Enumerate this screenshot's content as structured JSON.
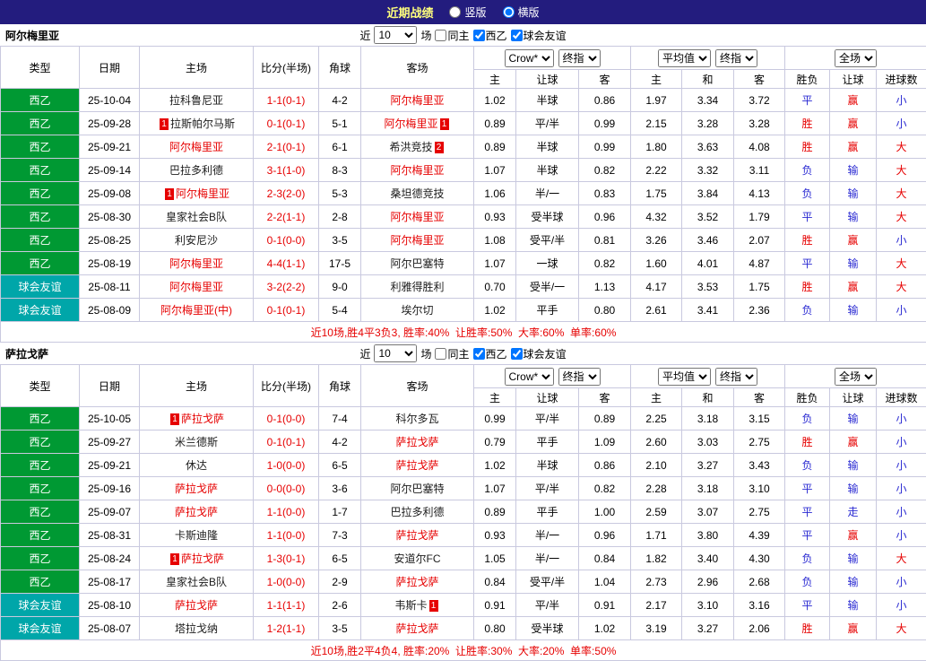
{
  "topbar": {
    "title": "近期战绩",
    "options": [
      {
        "label": "竖版",
        "selected": false
      },
      {
        "label": "横版",
        "selected": true
      }
    ]
  },
  "filterbar": {
    "near_prefix": "近",
    "near_value": "10",
    "near_suffix": "场",
    "checkboxes": [
      {
        "label": "同主",
        "checked": false
      },
      {
        "label": "西乙",
        "checked": true
      },
      {
        "label": "球会友谊",
        "checked": true
      }
    ]
  },
  "table_header": {
    "type": "类型",
    "date": "日期",
    "home": "主场",
    "score": "比分(半场)",
    "corner": "角球",
    "away": "客场",
    "odds_group": {
      "bookmaker": "Crow*",
      "final_label": "终指",
      "cols": [
        "主",
        "让球",
        "客"
      ]
    },
    "avg_group": {
      "label": "平均值",
      "final_label": "终指",
      "cols": [
        "主",
        "和",
        "客"
      ]
    },
    "full_group": {
      "label": "全场",
      "cols": [
        "胜负",
        "让球",
        "进球数"
      ]
    }
  },
  "colors": {
    "league_badge": "#009933",
    "friendly_badge": "#00a6a9",
    "win_red": "#e60000",
    "lose_blue": "#2a2ad2",
    "topbar_bg": "#231c7e",
    "topbar_title": "#ffff7d"
  },
  "sections": [
    {
      "team": "阿尔梅里亚",
      "summary": "近10场,胜4平3负3, 胜率:40%  让胜率:50%  大率:60%  单率:60%",
      "rows": [
        {
          "type": "西乙",
          "type_key": "league",
          "date": "25-10-04",
          "home": "拉科鲁尼亚",
          "home_card": "",
          "home_focal": false,
          "score": "1-1(0-1)",
          "corner": "4-2",
          "away": "阿尔梅里亚",
          "away_card": "",
          "away_focal": true,
          "odds": [
            "1.02",
            "半球",
            "0.86"
          ],
          "avg": [
            "1.97",
            "3.34",
            "3.72"
          ],
          "results": [
            "平",
            "赢",
            "小"
          ],
          "result_colors": [
            "blue",
            "red",
            "blue"
          ]
        },
        {
          "type": "西乙",
          "type_key": "league",
          "date": "25-09-28",
          "home": "拉斯帕尔马斯",
          "home_card": "1",
          "home_focal": false,
          "score": "0-1(0-1)",
          "corner": "5-1",
          "away": "阿尔梅里亚",
          "away_card": "1",
          "away_focal": true,
          "odds": [
            "0.89",
            "平/半",
            "0.99"
          ],
          "avg": [
            "2.15",
            "3.28",
            "3.28"
          ],
          "results": [
            "胜",
            "赢",
            "小"
          ],
          "result_colors": [
            "red",
            "red",
            "blue"
          ]
        },
        {
          "type": "西乙",
          "type_key": "league",
          "date": "25-09-21",
          "home": "阿尔梅里亚",
          "home_card": "",
          "home_focal": true,
          "score": "2-1(0-1)",
          "corner": "6-1",
          "away": "希洪竞技",
          "away_card": "2",
          "away_focal": false,
          "odds": [
            "0.89",
            "半球",
            "0.99"
          ],
          "avg": [
            "1.80",
            "3.63",
            "4.08"
          ],
          "results": [
            "胜",
            "赢",
            "大"
          ],
          "result_colors": [
            "red",
            "red",
            "red"
          ]
        },
        {
          "type": "西乙",
          "type_key": "league",
          "date": "25-09-14",
          "home": "巴拉多利德",
          "home_card": "",
          "home_focal": false,
          "score": "3-1(1-0)",
          "corner": "8-3",
          "away": "阿尔梅里亚",
          "away_card": "",
          "away_focal": true,
          "odds": [
            "1.07",
            "半球",
            "0.82"
          ],
          "avg": [
            "2.22",
            "3.32",
            "3.11"
          ],
          "results": [
            "负",
            "输",
            "大"
          ],
          "result_colors": [
            "blue",
            "blue",
            "red"
          ]
        },
        {
          "type": "西乙",
          "type_key": "league",
          "date": "25-09-08",
          "home": "阿尔梅里亚",
          "home_card": "1",
          "home_focal": true,
          "score": "2-3(2-0)",
          "corner": "5-3",
          "away": "桑坦德竞技",
          "away_card": "",
          "away_focal": false,
          "odds": [
            "1.06",
            "半/一",
            "0.83"
          ],
          "avg": [
            "1.75",
            "3.84",
            "4.13"
          ],
          "results": [
            "负",
            "输",
            "大"
          ],
          "result_colors": [
            "blue",
            "blue",
            "red"
          ]
        },
        {
          "type": "西乙",
          "type_key": "league",
          "date": "25-08-30",
          "home": "皇家社会B队",
          "home_card": "",
          "home_focal": false,
          "score": "2-2(1-1)",
          "corner": "2-8",
          "away": "阿尔梅里亚",
          "away_card": "",
          "away_focal": true,
          "odds": [
            "0.93",
            "受半球",
            "0.96"
          ],
          "avg": [
            "4.32",
            "3.52",
            "1.79"
          ],
          "results": [
            "平",
            "输",
            "大"
          ],
          "result_colors": [
            "blue",
            "blue",
            "red"
          ]
        },
        {
          "type": "西乙",
          "type_key": "league",
          "date": "25-08-25",
          "home": "利安尼沙",
          "home_card": "",
          "home_focal": false,
          "score": "0-1(0-0)",
          "corner": "3-5",
          "away": "阿尔梅里亚",
          "away_card": "",
          "away_focal": true,
          "odds": [
            "1.08",
            "受平/半",
            "0.81"
          ],
          "avg": [
            "3.26",
            "3.46",
            "2.07"
          ],
          "results": [
            "胜",
            "赢",
            "小"
          ],
          "result_colors": [
            "red",
            "red",
            "blue"
          ]
        },
        {
          "type": "西乙",
          "type_key": "league",
          "date": "25-08-19",
          "home": "阿尔梅里亚",
          "home_card": "",
          "home_focal": true,
          "score": "4-4(1-1)",
          "corner": "17-5",
          "away": "阿尔巴塞特",
          "away_card": "",
          "away_focal": false,
          "odds": [
            "1.07",
            "一球",
            "0.82"
          ],
          "avg": [
            "1.60",
            "4.01",
            "4.87"
          ],
          "results": [
            "平",
            "输",
            "大"
          ],
          "result_colors": [
            "blue",
            "blue",
            "red"
          ]
        },
        {
          "type": "球会友谊",
          "type_key": "friendly",
          "date": "25-08-11",
          "home": "阿尔梅里亚",
          "home_card": "",
          "home_focal": true,
          "score": "3-2(2-2)",
          "corner": "9-0",
          "away": "利雅得胜利",
          "away_card": "",
          "away_focal": false,
          "odds": [
            "0.70",
            "受半/一",
            "1.13"
          ],
          "avg": [
            "4.17",
            "3.53",
            "1.75"
          ],
          "results": [
            "胜",
            "赢",
            "大"
          ],
          "result_colors": [
            "red",
            "red",
            "red"
          ]
        },
        {
          "type": "球会友谊",
          "type_key": "friendly",
          "date": "25-08-09",
          "home": "阿尔梅里亚(中)",
          "home_card": "",
          "home_focal": true,
          "score": "0-1(0-1)",
          "corner": "5-4",
          "away": "埃尔切",
          "away_card": "",
          "away_focal": false,
          "odds": [
            "1.02",
            "平手",
            "0.80"
          ],
          "avg": [
            "2.61",
            "3.41",
            "2.36"
          ],
          "results": [
            "负",
            "输",
            "小"
          ],
          "result_colors": [
            "blue",
            "blue",
            "blue"
          ]
        }
      ]
    },
    {
      "team": "萨拉戈萨",
      "summary": "近10场,胜2平4负4, 胜率:20%  让胜率:30%  大率:20%  单率:50%",
      "rows": [
        {
          "type": "西乙",
          "type_key": "league",
          "date": "25-10-05",
          "home": "萨拉戈萨",
          "home_card": "1",
          "home_focal": true,
          "score": "0-1(0-0)",
          "corner": "7-4",
          "away": "科尔多瓦",
          "away_card": "",
          "away_focal": false,
          "odds": [
            "0.99",
            "平/半",
            "0.89"
          ],
          "avg": [
            "2.25",
            "3.18",
            "3.15"
          ],
          "results": [
            "负",
            "输",
            "小"
          ],
          "result_colors": [
            "blue",
            "blue",
            "blue"
          ]
        },
        {
          "type": "西乙",
          "type_key": "league",
          "date": "25-09-27",
          "home": "米兰德斯",
          "home_card": "",
          "home_focal": false,
          "score": "0-1(0-1)",
          "corner": "4-2",
          "away": "萨拉戈萨",
          "away_card": "",
          "away_focal": true,
          "odds": [
            "0.79",
            "平手",
            "1.09"
          ],
          "avg": [
            "2.60",
            "3.03",
            "2.75"
          ],
          "results": [
            "胜",
            "赢",
            "小"
          ],
          "result_colors": [
            "red",
            "red",
            "blue"
          ]
        },
        {
          "type": "西乙",
          "type_key": "league",
          "date": "25-09-21",
          "home": "休达",
          "home_card": "",
          "home_focal": false,
          "score": "1-0(0-0)",
          "corner": "6-5",
          "away": "萨拉戈萨",
          "away_card": "",
          "away_focal": true,
          "odds": [
            "1.02",
            "半球",
            "0.86"
          ],
          "avg": [
            "2.10",
            "3.27",
            "3.43"
          ],
          "results": [
            "负",
            "输",
            "小"
          ],
          "result_colors": [
            "blue",
            "blue",
            "blue"
          ]
        },
        {
          "type": "西乙",
          "type_key": "league",
          "date": "25-09-16",
          "home": "萨拉戈萨",
          "home_card": "",
          "home_focal": true,
          "score": "0-0(0-0)",
          "corner": "3-6",
          "away": "阿尔巴塞特",
          "away_card": "",
          "away_focal": false,
          "odds": [
            "1.07",
            "平/半",
            "0.82"
          ],
          "avg": [
            "2.28",
            "3.18",
            "3.10"
          ],
          "results": [
            "平",
            "输",
            "小"
          ],
          "result_colors": [
            "blue",
            "blue",
            "blue"
          ]
        },
        {
          "type": "西乙",
          "type_key": "league",
          "date": "25-09-07",
          "home": "萨拉戈萨",
          "home_card": "",
          "home_focal": true,
          "score": "1-1(0-0)",
          "corner": "1-7",
          "away": "巴拉多利德",
          "away_card": "",
          "away_focal": false,
          "odds": [
            "0.89",
            "平手",
            "1.00"
          ],
          "avg": [
            "2.59",
            "3.07",
            "2.75"
          ],
          "results": [
            "平",
            "走",
            "小"
          ],
          "result_colors": [
            "blue",
            "blue",
            "blue"
          ]
        },
        {
          "type": "西乙",
          "type_key": "league",
          "date": "25-08-31",
          "home": "卡斯迪隆",
          "home_card": "",
          "home_focal": false,
          "score": "1-1(0-0)",
          "corner": "7-3",
          "away": "萨拉戈萨",
          "away_card": "",
          "away_focal": true,
          "odds": [
            "0.93",
            "半/一",
            "0.96"
          ],
          "avg": [
            "1.71",
            "3.80",
            "4.39"
          ],
          "results": [
            "平",
            "赢",
            "小"
          ],
          "result_colors": [
            "blue",
            "red",
            "blue"
          ]
        },
        {
          "type": "西乙",
          "type_key": "league",
          "date": "25-08-24",
          "home": "萨拉戈萨",
          "home_card": "1",
          "home_focal": true,
          "score": "1-3(0-1)",
          "corner": "6-5",
          "away": "安道尔FC",
          "away_card": "",
          "away_focal": false,
          "odds": [
            "1.05",
            "半/一",
            "0.84"
          ],
          "avg": [
            "1.82",
            "3.40",
            "4.30"
          ],
          "results": [
            "负",
            "输",
            "大"
          ],
          "result_colors": [
            "blue",
            "blue",
            "red"
          ]
        },
        {
          "type": "西乙",
          "type_key": "league",
          "date": "25-08-17",
          "home": "皇家社会B队",
          "home_card": "",
          "home_focal": false,
          "score": "1-0(0-0)",
          "corner": "2-9",
          "away": "萨拉戈萨",
          "away_card": "",
          "away_focal": true,
          "odds": [
            "0.84",
            "受平/半",
            "1.04"
          ],
          "avg": [
            "2.73",
            "2.96",
            "2.68"
          ],
          "results": [
            "负",
            "输",
            "小"
          ],
          "result_colors": [
            "blue",
            "blue",
            "blue"
          ]
        },
        {
          "type": "球会友谊",
          "type_key": "friendly",
          "date": "25-08-10",
          "home": "萨拉戈萨",
          "home_card": "",
          "home_focal": true,
          "score": "1-1(1-1)",
          "corner": "2-6",
          "away": "韦斯卡",
          "away_card": "1",
          "away_focal": false,
          "odds": [
            "0.91",
            "平/半",
            "0.91"
          ],
          "avg": [
            "2.17",
            "3.10",
            "3.16"
          ],
          "results": [
            "平",
            "输",
            "小"
          ],
          "result_colors": [
            "blue",
            "blue",
            "blue"
          ]
        },
        {
          "type": "球会友谊",
          "type_key": "friendly",
          "date": "25-08-07",
          "home": "塔拉戈纳",
          "home_card": "",
          "home_focal": false,
          "score": "1-2(1-1)",
          "corner": "3-5",
          "away": "萨拉戈萨",
          "away_card": "",
          "away_focal": true,
          "odds": [
            "0.80",
            "受半球",
            "1.02"
          ],
          "avg": [
            "3.19",
            "3.27",
            "2.06"
          ],
          "results": [
            "胜",
            "赢",
            "大"
          ],
          "result_colors": [
            "red",
            "red",
            "red"
          ]
        }
      ]
    }
  ]
}
